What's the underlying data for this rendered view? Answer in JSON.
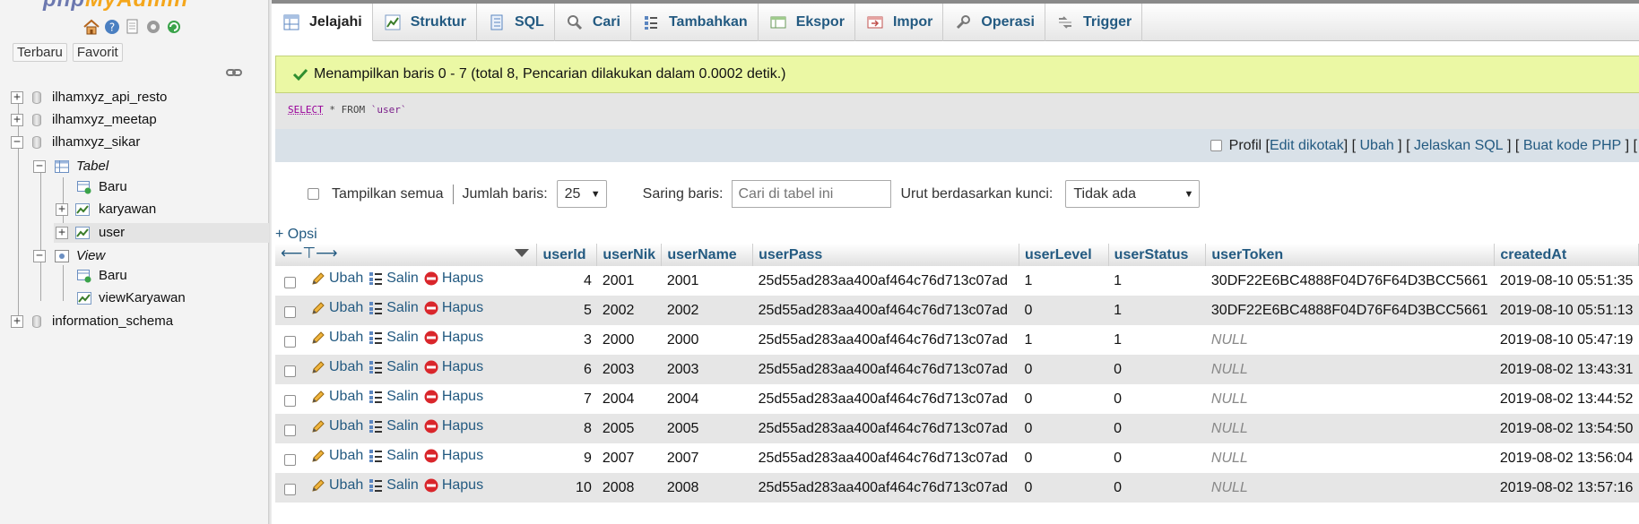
{
  "logo": {
    "part1": "php",
    "part2": "MyAdmin"
  },
  "sidebar": {
    "recent_label": "Terbaru",
    "favorite_label": "Favorit",
    "tree": {
      "db1": "ilhamxyz_api_resto",
      "db2": "ilhamxyz_meetap",
      "db3": "ilhamxyz_sikar",
      "tables_group": "Tabel",
      "new_table": "Baru",
      "table1": "karyawan",
      "table2": "user",
      "views_group": "View",
      "new_view": "Baru",
      "view1": "viewKaryawan",
      "db4": "information_schema"
    }
  },
  "tabs": [
    {
      "label": "Jelajahi",
      "icon": "browse-icon"
    },
    {
      "label": "Struktur",
      "icon": "structure-icon"
    },
    {
      "label": "SQL",
      "icon": "sql-icon"
    },
    {
      "label": "Cari",
      "icon": "search-icon"
    },
    {
      "label": "Tambahkan",
      "icon": "insert-icon"
    },
    {
      "label": "Ekspor",
      "icon": "export-icon"
    },
    {
      "label": "Impor",
      "icon": "import-icon"
    },
    {
      "label": "Operasi",
      "icon": "operations-icon"
    },
    {
      "label": "Trigger",
      "icon": "trigger-icon"
    }
  ],
  "notice": "Menampilkan baris 0 - 7 (total 8, Pencarian dilakukan dalam 0.0002 detik.)",
  "sql": {
    "select": "SELECT",
    "rest": " * FROM ",
    "table": "`user`"
  },
  "profile": {
    "label": "Profil",
    "edit_inline": "Edit dikotak",
    "edit": "Ubah",
    "explain": "Jelaskan SQL",
    "php_code": "Buat kode PHP"
  },
  "nav": {
    "show_all": "Tampilkan semua",
    "rows_label": "Jumlah baris:",
    "rows_value": "25",
    "filter_label": "Saring baris:",
    "filter_placeholder": "Cari di tabel ini",
    "sort_label": "Urut berdasarkan kunci:",
    "sort_value": "Tidak ada"
  },
  "options_link": "+ Opsi",
  "actions": {
    "edit": "Ubah",
    "copy": "Salin",
    "delete": "Hapus"
  },
  "columns": [
    "userId",
    "userNik",
    "userName",
    "userPass",
    "userLevel",
    "userStatus",
    "userToken",
    "createdAt"
  ],
  "rows": [
    [
      "4",
      "2001",
      "2001",
      "25d55ad283aa400af464c76d713c07ad",
      "1",
      "1",
      "30DF22E6BC4888F04D76F64D3BCC5661",
      "2019-08-10 05:51:35"
    ],
    [
      "5",
      "2002",
      "2002",
      "25d55ad283aa400af464c76d713c07ad",
      "0",
      "1",
      "30DF22E6BC4888F04D76F64D3BCC5661",
      "2019-08-10 05:51:13"
    ],
    [
      "3",
      "2000",
      "2000",
      "25d55ad283aa400af464c76d713c07ad",
      "1",
      "1",
      "NULL",
      "2019-08-10 05:47:19"
    ],
    [
      "6",
      "2003",
      "2003",
      "25d55ad283aa400af464c76d713c07ad",
      "0",
      "0",
      "NULL",
      "2019-08-02 13:43:31"
    ],
    [
      "7",
      "2004",
      "2004",
      "25d55ad283aa400af464c76d713c07ad",
      "0",
      "0",
      "NULL",
      "2019-08-02 13:44:52"
    ],
    [
      "8",
      "2005",
      "2005",
      "25d55ad283aa400af464c76d713c07ad",
      "0",
      "0",
      "NULL",
      "2019-08-02 13:54:50"
    ],
    [
      "9",
      "2007",
      "2007",
      "25d55ad283aa400af464c76d713c07ad",
      "0",
      "0",
      "NULL",
      "2019-08-02 13:56:04"
    ],
    [
      "10",
      "2008",
      "2008",
      "25d55ad283aa400af464c76d713c07ad",
      "0",
      "0",
      "NULL",
      "2019-08-02 13:57:16"
    ]
  ]
}
